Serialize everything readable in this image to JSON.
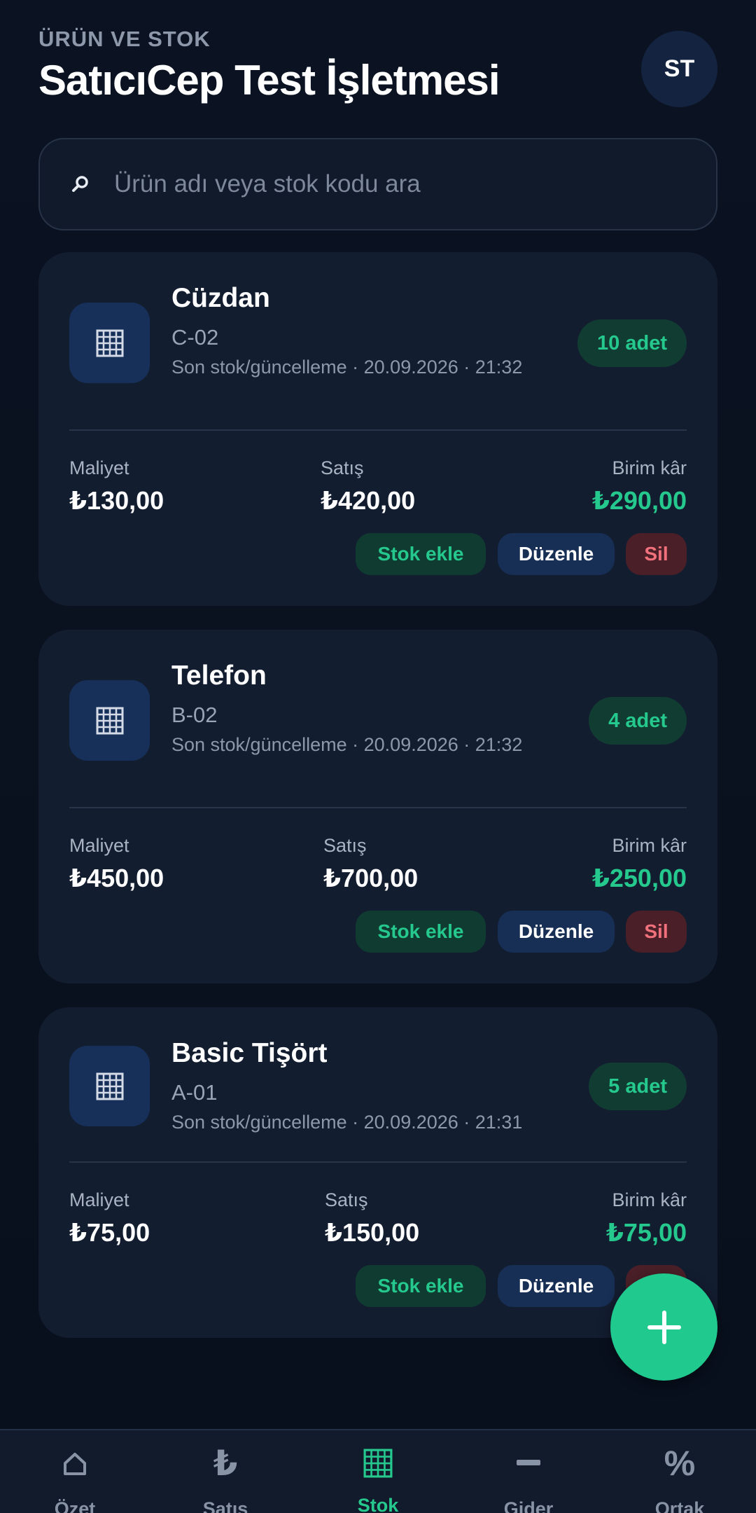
{
  "header": {
    "eyebrow": "ÜRÜN VE STOK",
    "title": "SatıcıCep Test İşletmesi",
    "avatar_initials": "ST"
  },
  "search": {
    "placeholder": "Ürün adı veya stok kodu ara",
    "icon": "search-icon"
  },
  "metric_labels": {
    "cost": "Maliyet",
    "sale": "Satış",
    "profit": "Birim kâr"
  },
  "actions": {
    "add_stock": "Stok ekle",
    "edit": "Düzenle",
    "delete": "Sil"
  },
  "products": [
    {
      "name": "Cüzdan",
      "code": "C-02",
      "updated": "Son stok/güncelleme · 20.09.2026 · 21:32",
      "quantity": "10 adet",
      "cost": "₺130,00",
      "sale": "₺420,00",
      "profit": "₺290,00",
      "icon": "product-grid-icon"
    },
    {
      "name": "Telefon",
      "code": "B-02",
      "updated": "Son stok/güncelleme · 20.09.2026 · 21:32",
      "quantity": "4 adet",
      "cost": "₺450,00",
      "sale": "₺700,00",
      "profit": "₺250,00",
      "icon": "product-grid-icon"
    },
    {
      "name": "Basic Tişört",
      "code": "A-01",
      "updated": "Son stok/güncelleme · 20.09.2026 · 21:31",
      "quantity": "5 adet",
      "cost": "₺75,00",
      "sale": "₺150,00",
      "profit": "₺75,00",
      "icon": "product-grid-icon"
    }
  ],
  "fab": {
    "icon": "plus-icon"
  },
  "bottom_nav": {
    "active": "Stok",
    "items": [
      {
        "label": "Özet",
        "icon": "home-icon",
        "glyph": "⌂"
      },
      {
        "label": "Satış",
        "icon": "lira-icon",
        "glyph": "₺"
      },
      {
        "label": "Stok",
        "icon": "stock-grid-icon",
        "glyph": "▦"
      },
      {
        "label": "Gider",
        "icon": "minus-icon",
        "glyph": "−"
      },
      {
        "label": "Ortak",
        "icon": "percent-icon",
        "glyph": "%"
      }
    ]
  },
  "colors": {
    "background": "#0a1120",
    "card": "#131d30",
    "accent_green": "#25c98e",
    "danger_red": "#f0717c",
    "edit_blue": "#172e55"
  }
}
